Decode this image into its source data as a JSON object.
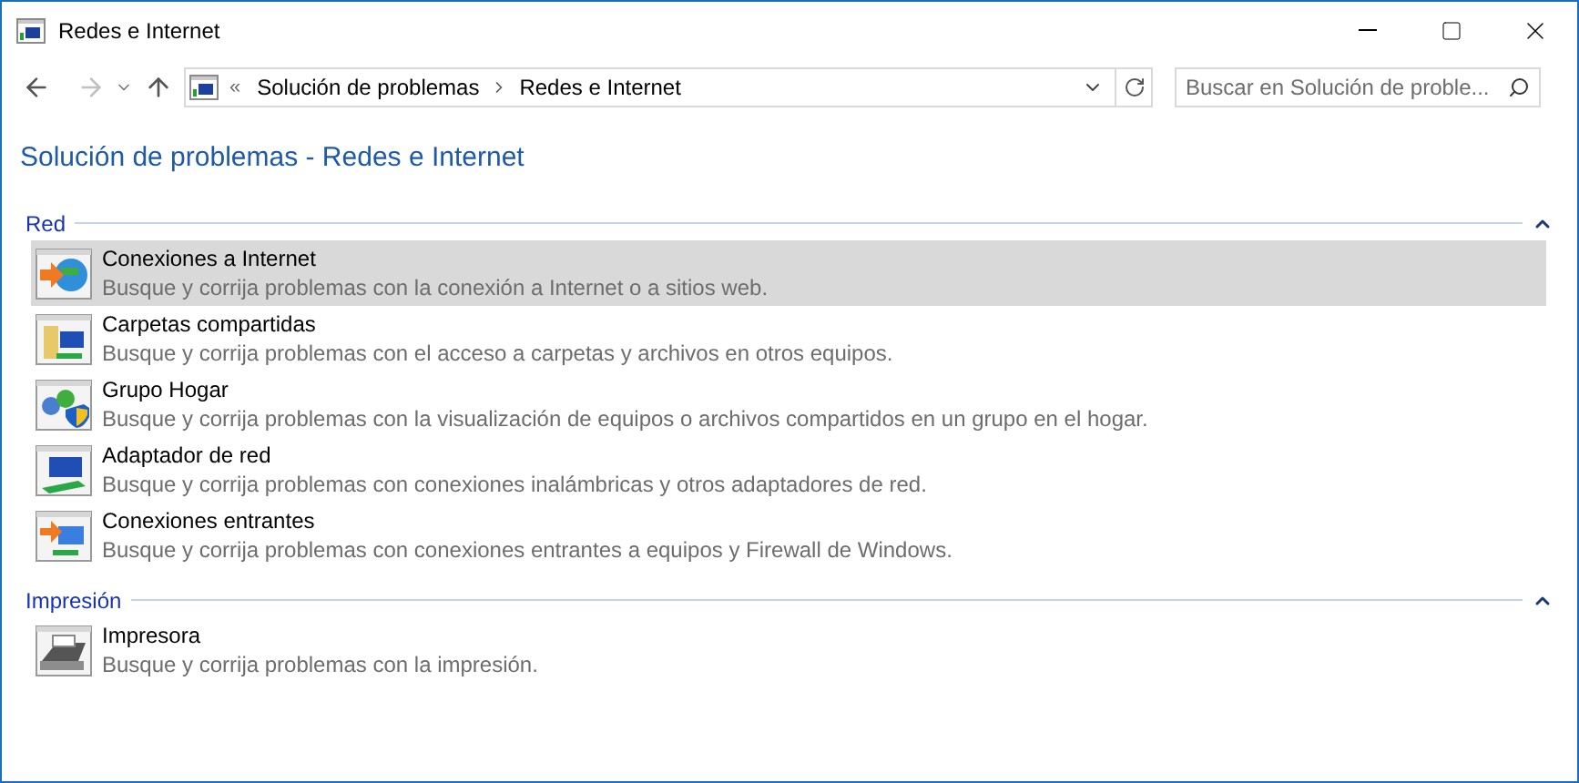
{
  "window": {
    "title": "Redes e Internet"
  },
  "address_bar": {
    "overflow": "«",
    "crumbs": [
      "Solución de problemas",
      "Redes e Internet"
    ]
  },
  "search": {
    "placeholder": "Buscar en Solución de proble..."
  },
  "heading": "Solución de problemas - Redes e Internet",
  "sections": [
    {
      "title": "Red",
      "expanded": true,
      "items": [
        {
          "name": "Conexiones a Internet",
          "description": "Busque y corrija problemas con la conexión a Internet o a sitios web.",
          "selected": true
        },
        {
          "name": "Carpetas compartidas",
          "description": "Busque y corrija problemas con el acceso a carpetas y archivos en otros equipos.",
          "selected": false
        },
        {
          "name": "Grupo Hogar",
          "description": "Busque y corrija problemas con la visualización de equipos o archivos compartidos en un grupo en el hogar.",
          "selected": false
        },
        {
          "name": "Adaptador de red",
          "description": "Busque y corrija problemas con conexiones inalámbricas y otros adaptadores de red.",
          "selected": false
        },
        {
          "name": "Conexiones entrantes",
          "description": "Busque y corrija problemas con conexiones entrantes a equipos y Firewall de Windows.",
          "selected": false
        }
      ]
    },
    {
      "title": "Impresión",
      "expanded": true,
      "items": [
        {
          "name": "Impresora",
          "description": "Busque y corrija problemas con la impresión.",
          "selected": false
        }
      ]
    }
  ]
}
